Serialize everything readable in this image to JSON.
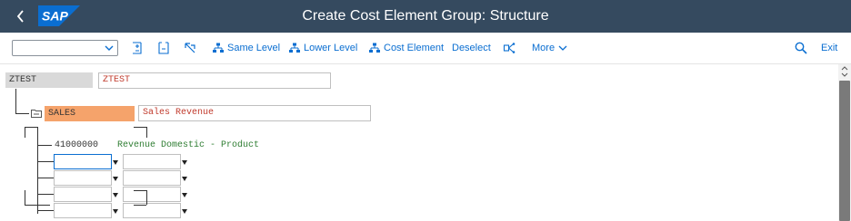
{
  "shell": {
    "title": "Create Cost Element Group: Structure",
    "logo_text": "SAP",
    "brand_color": "#354a5f",
    "logo_color": "#0a6ed1"
  },
  "toolbar": {
    "select_value": "",
    "buttons": [
      {
        "label": "Same Level",
        "icon": "hierarchy-icon"
      },
      {
        "label": "Lower Level",
        "icon": "hierarchy-icon"
      },
      {
        "label": "Cost Element",
        "icon": "hierarchy-icon"
      },
      {
        "label": "Deselect"
      },
      {
        "label": "More",
        "icon": "chevron-down-icon"
      }
    ],
    "search_icon": "search-icon",
    "exit_label": "Exit",
    "accent_color": "#0a6ed1"
  },
  "tree": {
    "root": {
      "id": "ZTEST",
      "text": "ZTEST"
    },
    "group": {
      "id": "SALES",
      "text": "Sales Revenue"
    },
    "element": {
      "id": "41000000",
      "text": "Revenue Domestic - Product"
    },
    "highlight_color": "#f5a36b",
    "root_bg": "#d9d9d9",
    "text_red": "#c0392b",
    "text_green": "#2e7d32"
  }
}
